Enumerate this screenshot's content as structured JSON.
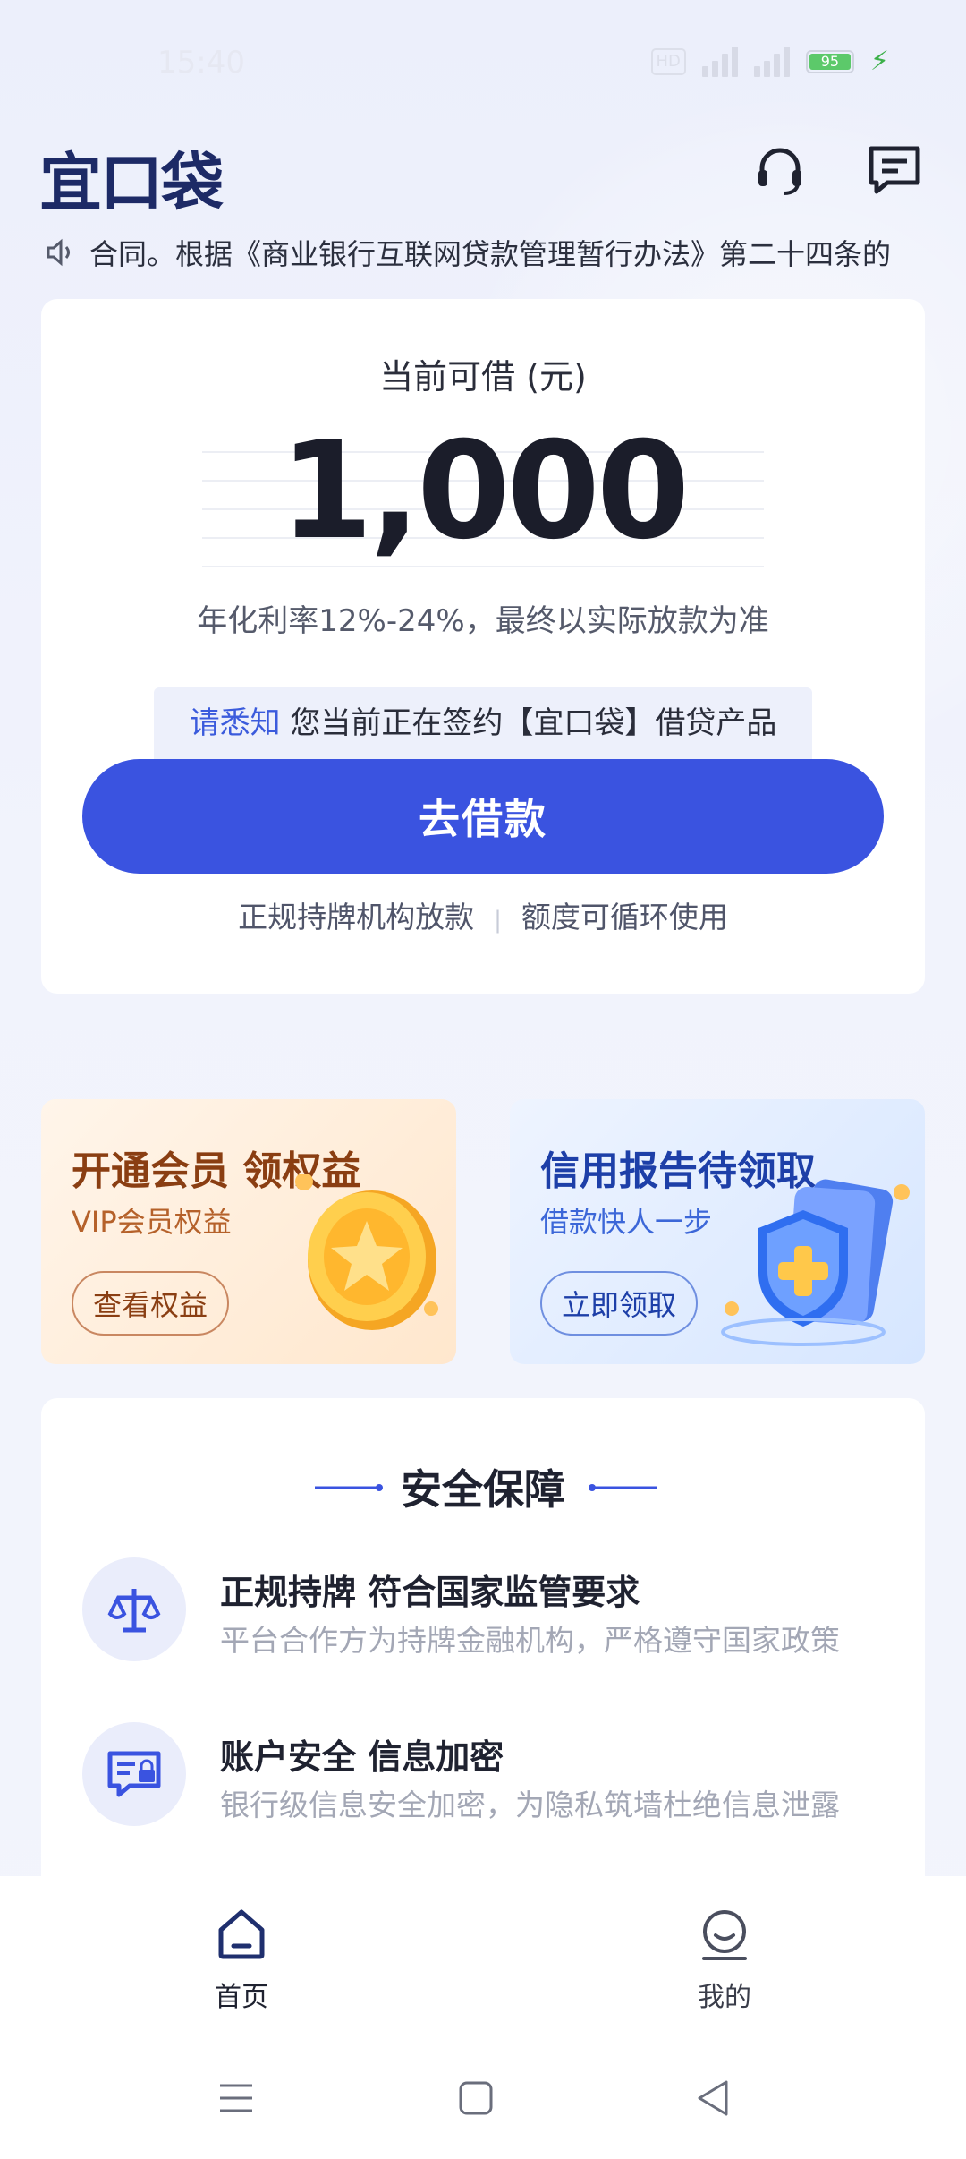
{
  "status_bar": {
    "time": "15:40",
    "hd_label": "HD",
    "battery_level": "95"
  },
  "header": {
    "logo": "宜口袋",
    "icons": [
      "headset-icon",
      "message-icon"
    ]
  },
  "notice": {
    "text": "合同。根据《商业银行互联网贷款管理暂行办法》第二十四条的"
  },
  "loan": {
    "label": "当前可借 (元)",
    "amount": "1,000",
    "rate_text": "年化利率12%-24%，最终以实际放款为准",
    "tip_highlight": "请悉知",
    "tip_text": " 您当前正在签约【宜口袋】借贷产品",
    "button_label": "去借款",
    "feature_1": "正规持牌机构放款",
    "feature_2": "额度可循环使用"
  },
  "promos": {
    "vip": {
      "title": "开通会员 领权益",
      "subtitle": "VIP会员权益",
      "button": "查看权益"
    },
    "credit": {
      "title": "信用报告待领取",
      "subtitle": "借款快人一步",
      "button": "立即领取"
    }
  },
  "security": {
    "title": "安全保障",
    "items": [
      {
        "title": "正规持牌 符合国家监管要求",
        "desc": "平台合作方为持牌金融机构，严格遵守国家政策"
      },
      {
        "title": "账户安全 信息加密",
        "desc": "银行级信息安全加密，为隐私筑墙杜绝信息泄露"
      }
    ]
  },
  "bottom_nav": {
    "items": [
      {
        "label": "首页",
        "icon": "home-icon",
        "active": true
      },
      {
        "label": "我的",
        "icon": "profile-icon",
        "active": false
      }
    ]
  },
  "colors": {
    "accent": "#3a53e0",
    "logo": "#1d2a66",
    "highlight": "#3b5bdc"
  }
}
